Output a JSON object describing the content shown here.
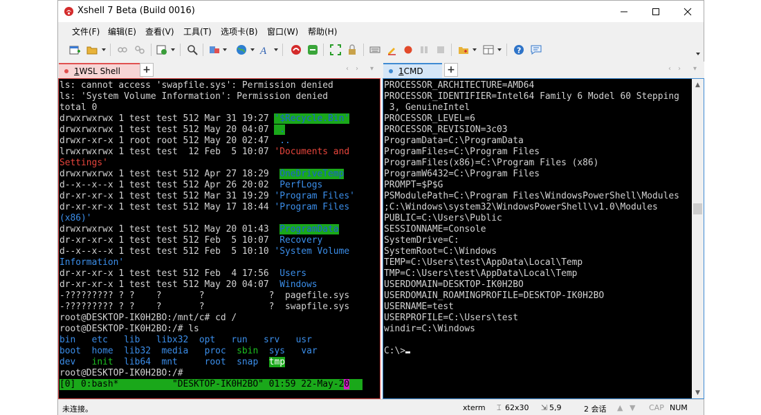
{
  "window": {
    "title": "Xshell 7 Beta (Build 0016)"
  },
  "menu": [
    "文件(F)",
    "编辑(E)",
    "查看(V)",
    "工具(T)",
    "选项卡(B)",
    "窗口(W)",
    "帮助(H)"
  ],
  "tabs_left": [
    {
      "num": "1",
      "label": " WSL Shell",
      "active": true,
      "dot_color": "#e0504f"
    }
  ],
  "tabs_right": [
    {
      "num": "1",
      "label": " CMD",
      "active": true,
      "dot_color": "#3e8ad2"
    }
  ],
  "left_terminal": [
    [
      {
        "t": "ls: cannot access 'swapfile.sys': Permission denied"
      }
    ],
    [
      {
        "t": "ls: 'System Volume Information': Permission denied"
      }
    ],
    [
      {
        "t": "total 0"
      }
    ],
    [
      {
        "t": "drwxrwxrwx 1 test test 512 Mar 31 19:27 "
      },
      {
        "t": "'$Recycle.Bin'",
        "c": "bg-green"
      }
    ],
    [
      {
        "t": "drwxrwxrwx 1 test test 512 May 20 04:07 "
      },
      {
        "t": " .",
        "c": "bg-green"
      }
    ],
    [
      {
        "t": "drwxr-xr-x 1 root root 512 May 20 02:47 "
      },
      {
        "t": " ..",
        "c": "c-blue"
      }
    ],
    [
      {
        "t": "lrwxrwxrwx 1 test test  12 Feb  5 10:07 "
      },
      {
        "t": "'Documents and",
        "c": "c-red"
      }
    ],
    [
      {
        "t": "Settings'",
        "c": "c-red"
      }
    ],
    [
      {
        "t": "drwxrwxrwx 1 test test 512 Apr 27 18:29 "
      },
      {
        "t": " "
      },
      {
        "t": "OneDriveTemp",
        "c": "bg-green"
      }
    ],
    [
      {
        "t": "d--x--x--x 1 test test 512 Apr 26 20:02 "
      },
      {
        "t": " PerfLogs",
        "c": "c-blue"
      }
    ],
    [
      {
        "t": "dr-xr-xr-x 1 test test 512 Mar 31 19:29 "
      },
      {
        "t": "'Program Files'",
        "c": "c-blue"
      }
    ],
    [
      {
        "t": "dr-xr-xr-x 1 test test 512 May 17 18:44 "
      },
      {
        "t": "'Program Files",
        "c": "c-blue"
      }
    ],
    [
      {
        "t": "(x86)'",
        "c": "c-blue"
      }
    ],
    [
      {
        "t": "drwxrwxrwx 1 test test 512 May 20 01:43 "
      },
      {
        "t": " "
      },
      {
        "t": "ProgramData",
        "c": "bg-green"
      }
    ],
    [
      {
        "t": "dr-xr-xr-x 1 test test 512 Feb  5 10:07 "
      },
      {
        "t": " Recovery",
        "c": "c-blue"
      }
    ],
    [
      {
        "t": "d--x--x--x 1 test test 512 Feb  5 10:10 "
      },
      {
        "t": "'System Volume",
        "c": "c-blue"
      }
    ],
    [
      {
        "t": "Information'",
        "c": "c-blue"
      }
    ],
    [
      {
        "t": "dr-xr-xr-x 1 test test 512 Feb  4 17:56 "
      },
      {
        "t": " Users",
        "c": "c-blue"
      }
    ],
    [
      {
        "t": "dr-xr-xr-x 1 test test 512 May 20 04:07 "
      },
      {
        "t": " Windows",
        "c": "c-blue"
      }
    ],
    [
      {
        "t": "-????????? ? ?    ?       ?            ?  pagefile.sys"
      }
    ],
    [
      {
        "t": "-????????? ? ?    ?       ?            ?  swapfile.sys"
      }
    ],
    [
      {
        "t": "root@DESKTOP-IK0H2BO:/mnt/c# cd /"
      }
    ],
    [
      {
        "t": "root@DESKTOP-IK0H2BO:/# ls"
      }
    ],
    [
      {
        "t": "bin   ",
        "c": "c-blue"
      },
      {
        "t": "etc   ",
        "c": "c-blue"
      },
      {
        "t": "lib   ",
        "c": "c-blue"
      },
      {
        "t": "libx32  ",
        "c": "c-blue"
      },
      {
        "t": "opt   ",
        "c": "c-blue"
      },
      {
        "t": "run   ",
        "c": "c-blue"
      },
      {
        "t": "srv   ",
        "c": "c-blue"
      },
      {
        "t": "usr",
        "c": "c-blue"
      }
    ],
    [
      {
        "t": "boot  ",
        "c": "c-blue"
      },
      {
        "t": "home  ",
        "c": "c-blue"
      },
      {
        "t": "lib32  ",
        "c": "c-blue"
      },
      {
        "t": "media   ",
        "c": "c-blue"
      },
      {
        "t": "proc  ",
        "c": "c-blue"
      },
      {
        "t": "sbin  ",
        "c": "c-green"
      },
      {
        "t": "sys   ",
        "c": "c-blue"
      },
      {
        "t": "var",
        "c": "c-blue"
      }
    ],
    [
      {
        "t": "dev   ",
        "c": "c-blue"
      },
      {
        "t": "init  ",
        "c": "c-green"
      },
      {
        "t": "lib64  ",
        "c": "c-blue"
      },
      {
        "t": "mnt     ",
        "c": "c-blue"
      },
      {
        "t": "root  ",
        "c": "c-blue"
      },
      {
        "t": "snap  ",
        "c": "c-blue"
      },
      {
        "t": "tmp",
        "c": "bg-green-w"
      }
    ],
    [
      {
        "t": "root@DESKTOP-IK0H2BO:/#"
      }
    ]
  ],
  "tmux_status": {
    "left": "[0] 0:bash*",
    "right": "\"DESKTOP-IK0H2BO\" 01:59 22-May-2",
    "end": "0"
  },
  "right_terminal": [
    "PROCESSOR_ARCHITECTURE=AMD64",
    "PROCESSOR_IDENTIFIER=Intel64 Family 6 Model 60 Stepping",
    " 3, GenuineIntel",
    "PROCESSOR_LEVEL=6",
    "PROCESSOR_REVISION=3c03",
    "ProgramData=C:\\ProgramData",
    "ProgramFiles=C:\\Program Files",
    "ProgramFiles(x86)=C:\\Program Files (x86)",
    "ProgramW6432=C:\\Program Files",
    "PROMPT=$P$G",
    "PSModulePath=C:\\Program Files\\WindowsPowerShell\\Modules",
    ";C:\\Windows\\system32\\WindowsPowerShell\\v1.0\\Modules",
    "PUBLIC=C:\\Users\\Public",
    "SESSIONNAME=Console",
    "SystemDrive=C:",
    "SystemRoot=C:\\Windows",
    "TEMP=C:\\Users\\test\\AppData\\Local\\Temp",
    "TMP=C:\\Users\\test\\AppData\\Local\\Temp",
    "USERDOMAIN=DESKTOP-IK0H2BO",
    "USERDOMAIN_ROAMINGPROFILE=DESKTOP-IK0H2BO",
    "USERNAME=test",
    "USERPROFILE=C:\\Users\\test",
    "windir=C:\\Windows",
    "",
    "C:\\>"
  ],
  "status": {
    "connection": "未连接。",
    "term_type": "xterm",
    "size": "62x30",
    "cursor": "5,9",
    "sessions": "2 会话",
    "cap": "CAP",
    "num": "NUM"
  },
  "colors": {
    "left_pane_border": "#e0504f",
    "right_pane_border": "#3e8ad2",
    "tmux_green": "#1aa81a"
  }
}
